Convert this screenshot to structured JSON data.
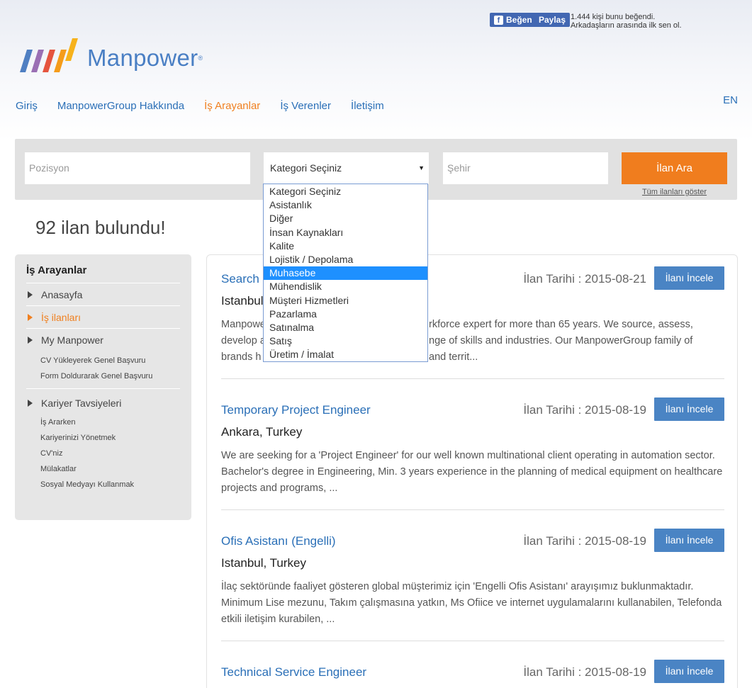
{
  "facebook": {
    "like_label": "Beğen",
    "share_label": "Paylaş",
    "social_text": "1.444 kişi bunu beğendi. Arkadaşların arasında ilk sen ol."
  },
  "logo": {
    "text": "Manpower",
    "reg": "®"
  },
  "nav": {
    "items": [
      "Giriş",
      "ManpowerGroup Hakkında",
      "İş Arayanlar",
      "İş Verenler",
      "İletişim"
    ],
    "active_index": 2,
    "lang": "EN"
  },
  "search": {
    "position_placeholder": "Pozisyon",
    "category_selected": "Kategori Seçiniz",
    "city_placeholder": "Şehir",
    "button_label": "İlan Ara",
    "show_all_label": "Tüm ilanları göster"
  },
  "dropdown": {
    "options": [
      "Kategori Seçiniz",
      "Asistanlık",
      "Diğer",
      "İnsan Kaynakları",
      "Kalite",
      "Lojistik / Depolama",
      "Muhasebe",
      "Mühendislik",
      "Müşteri Hizmetleri",
      "Pazarlama",
      "Satınalma",
      "Satış",
      "Üretim / İmalat"
    ],
    "highlighted": "Muhasebe"
  },
  "results": {
    "count_text": "92 ilan bulundu!"
  },
  "sidebar": {
    "title": "İş Arayanlar",
    "items": [
      {
        "label": "Anasayfa"
      },
      {
        "label": "İş ilanları"
      },
      {
        "label": "My Manpower"
      }
    ],
    "my_manpower_subs": [
      "CV Yükleyerek Genel Başvuru",
      "Form Doldurarak Genel Başvuru"
    ],
    "career_label": "Kariyer Tavsiyeleri",
    "career_subs": [
      "İş Ararken",
      "Kariyerinizi Yönetmek",
      "CV'niz",
      "Mülakatlar",
      "Sosyal Medyayı Kullanmak"
    ]
  },
  "jobs": [
    {
      "title": "Search",
      "location": "Istanbul",
      "date": "İlan Tarihi : 2015-08-21",
      "desc_line1_left": "Manpowe",
      "desc_line1_right": "rkforce expert for more than 65 years. We source, assess,",
      "desc_line2_left": "develop a",
      "desc_line2_right": "nge of skills and industries. Our ManpowerGroup family of",
      "desc_line3_left": "brands h",
      "desc_line3_right": "and territ...",
      "button": "İlanı İncele"
    },
    {
      "title": "Temporary Project Engineer",
      "location": "Ankara, Turkey",
      "date": "İlan Tarihi : 2015-08-19",
      "desc": "We are seeking for a 'Project Engineer' for our well known multinational client operating in automation sector. Bachelor's degree in Engineering, Min. 3 years experience in the planning of medical equipment on healthcare projects and programs, ...",
      "button": "İlanı İncele"
    },
    {
      "title": "Ofis Asistanı (Engelli)",
      "location": "Istanbul, Turkey",
      "date": "İlan Tarihi : 2015-08-19",
      "desc": "İlaç sektöründe faaliyet gösteren global müşterimiz için 'Engelli Ofis Asistanı' arayışımız buklunmaktadır. Minimum Lise mezunu, Takım çalışmasına yatkın, Ms Ofiice ve internet uygulamalarını kullanabilen, Telefonda etkili iletişim kurabilen, ...",
      "button": "İlanı İncele"
    },
    {
      "title": "Technical Service Engineer",
      "date": "İlan Tarihi : 2015-08-19",
      "button": "İlanı İncele"
    }
  ],
  "colors": {
    "brand_blue": "#2a6fb7",
    "accent_orange": "#f07d1e",
    "button_blue": "#4a84c4",
    "dropdown_highlight": "#1e90ff"
  }
}
